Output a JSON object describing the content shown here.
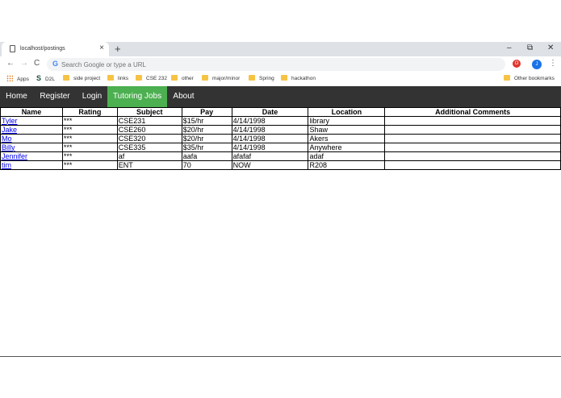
{
  "browser": {
    "tab_title": "localhost/postings",
    "tab_close": "×",
    "new_tab": "+",
    "window_controls": {
      "minimize": "–",
      "restore": "⧉",
      "close": "✕"
    },
    "nav": {
      "back": "←",
      "forward": "→",
      "reload": "C"
    },
    "omnibox_placeholder": "Search Google or type a URL",
    "google_glyph": "G",
    "extension_glyph": "O",
    "avatar_initial": "J",
    "menu_glyph": "⋮",
    "icons": [
      "page-icon",
      "back-arrow-icon",
      "forward-arrow-icon",
      "reload-icon",
      "google-icon",
      "opera-icon",
      "avatar",
      "menu-icon",
      "apps-grid-icon",
      "folder-icon"
    ]
  },
  "bookmarks": {
    "apps": "Apps",
    "d2l_glyph": "S",
    "d2l": "D2L",
    "items": [
      "side project",
      "links",
      "CSE 232",
      "other",
      "major/minor",
      "Spring",
      "hackathon"
    ],
    "other": "Other bookmarks"
  },
  "nav": {
    "items": [
      {
        "label": "Home"
      },
      {
        "label": "Register"
      },
      {
        "label": "Login"
      },
      {
        "label": "Tutoring Jobs"
      },
      {
        "label": "About"
      }
    ],
    "active_color": "#4caf50",
    "bar_color": "#333333"
  },
  "table": {
    "headers": [
      "Name",
      "Rating",
      "Subject",
      "Pay",
      "Date",
      "Location",
      "Additional Comments"
    ],
    "rows": [
      [
        "Tyler",
        "***",
        "CSE231",
        "$15/hr",
        "4/14/1998",
        "library",
        ""
      ],
      [
        "Jake",
        "***",
        "CSE260",
        "$20/hr",
        "4/14/1998",
        "Shaw",
        ""
      ],
      [
        "Mo",
        "***",
        "CSE320",
        "$20/hr",
        "4/14/1998",
        "Akers",
        ""
      ],
      [
        "Billy",
        "***",
        "CSE335",
        "$35/hr",
        "4/14/1998",
        "Anywhere",
        ""
      ],
      [
        "Jennifer",
        "***",
        "af",
        "aafa",
        "afafaf",
        "adaf",
        ""
      ],
      [
        "tim",
        "***",
        "ENT",
        "70",
        "NOW",
        "R208",
        ""
      ]
    ]
  }
}
